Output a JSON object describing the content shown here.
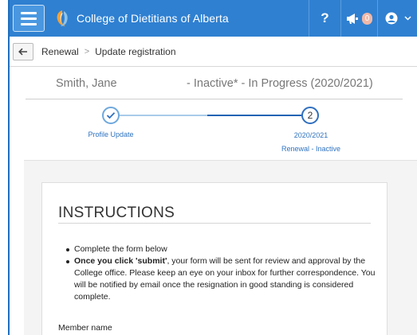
{
  "app": {
    "title": "College of Dietitians of Alberta",
    "brand_color": "#2f80d1"
  },
  "topbar": {
    "menu_icon": "hamburger-icon",
    "logo_icon": "college-logo-icon",
    "help_label": "?",
    "notifications_icon": "megaphone-icon",
    "notifications_count": "0",
    "user_icon": "user-circle-icon",
    "user_menu_icon": "chevron-down-icon"
  },
  "breadcrumb": {
    "back_icon": "arrow-left-icon",
    "items": [
      "Renewal",
      "Update registration"
    ],
    "separator": ">"
  },
  "registration": {
    "name": "Smith, Jane",
    "status": "- Inactive* - In Progress (2020/2021)"
  },
  "stepper": {
    "steps": [
      {
        "label": "Profile Update",
        "state": "completed",
        "icon": "check-icon"
      },
      {
        "number": "2",
        "label_line1": "2020/2021",
        "label_line2": "Renewal - Inactive",
        "state": "current"
      }
    ],
    "active_color": "#1f63b4"
  },
  "instructions": {
    "heading": "INSTRUCTIONS",
    "items": [
      {
        "bold": "",
        "text": "Complete the form below"
      },
      {
        "bold": "Once you click 'submit'",
        "text": ", your form will be sent for review and approval by the College office. Please keep an eye on your inbox for further correspondence. You will be notified by email once the resignation in good standing is considered complete."
      }
    ]
  },
  "form": {
    "member_name_label": "Member name"
  }
}
